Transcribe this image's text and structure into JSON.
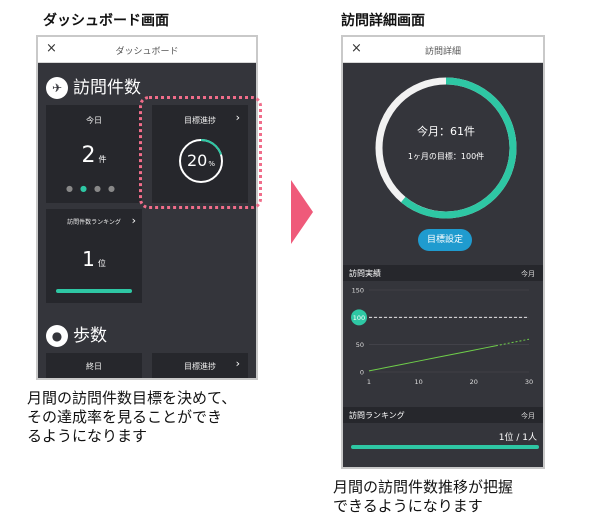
{
  "left_title": "ダッシュボード画面",
  "right_title": "訪問詳細画面",
  "left_phone": {
    "close": "×",
    "header": "ダッシュボード",
    "visits_title": "訪問件数",
    "today": {
      "label": "今日",
      "value": "2",
      "unit": "件"
    },
    "progress": {
      "label": "目標進捗",
      "value": "20",
      "unit": "%",
      "fraction": 0.2
    },
    "ranking": {
      "label": "訪問件数ランキング",
      "value": "1",
      "unit": "位"
    },
    "steps_title": "歩数",
    "allday_label": "終日",
    "steps_progress_label": "目標進捗",
    "chevron": "›"
  },
  "right_phone": {
    "close": "×",
    "header": "訪問詳細",
    "month_label": "今月：61件",
    "goal_label": "1ヶ月の目標：100件",
    "ring_fraction": 0.61,
    "goal_button": "目標設定",
    "results_title": "訪問実績",
    "results_period": "今月",
    "ranking_title": "訪問ランキング",
    "ranking_period": "今月",
    "ranking_value": "1位 / 1人"
  },
  "chart_data": {
    "type": "line",
    "x_ticks": [
      "1",
      "10",
      "20",
      "30"
    ],
    "y_ticks": [
      "150",
      "100",
      "50",
      "0"
    ],
    "xlim": [
      1,
      30
    ],
    "ylim": [
      0,
      150
    ],
    "target": {
      "label": "100",
      "value": 100
    },
    "series": [
      {
        "values": [
          [
            1,
            2
          ],
          [
            4,
            8
          ],
          [
            7,
            14
          ],
          [
            10,
            20
          ],
          [
            13,
            26
          ],
          [
            16,
            32
          ],
          [
            19,
            38
          ],
          [
            22,
            44
          ],
          [
            24,
            48
          ]
        ],
        "style": "solid"
      },
      {
        "values": [
          [
            24,
            48
          ],
          [
            30,
            60
          ]
        ],
        "style": "dotted"
      }
    ]
  },
  "left_caption": [
    "月間の訪問件数目標を決めて、",
    "その達成率を見ることができ",
    "るようになります"
  ],
  "right_caption": [
    "月間の訪問件数推移が把握",
    "できるようになります"
  ],
  "colors": {
    "accent": "#2ec7a4",
    "button": "#1f9bcf",
    "highlight": "#f06d8a",
    "arrow": "#ef5a7a"
  }
}
